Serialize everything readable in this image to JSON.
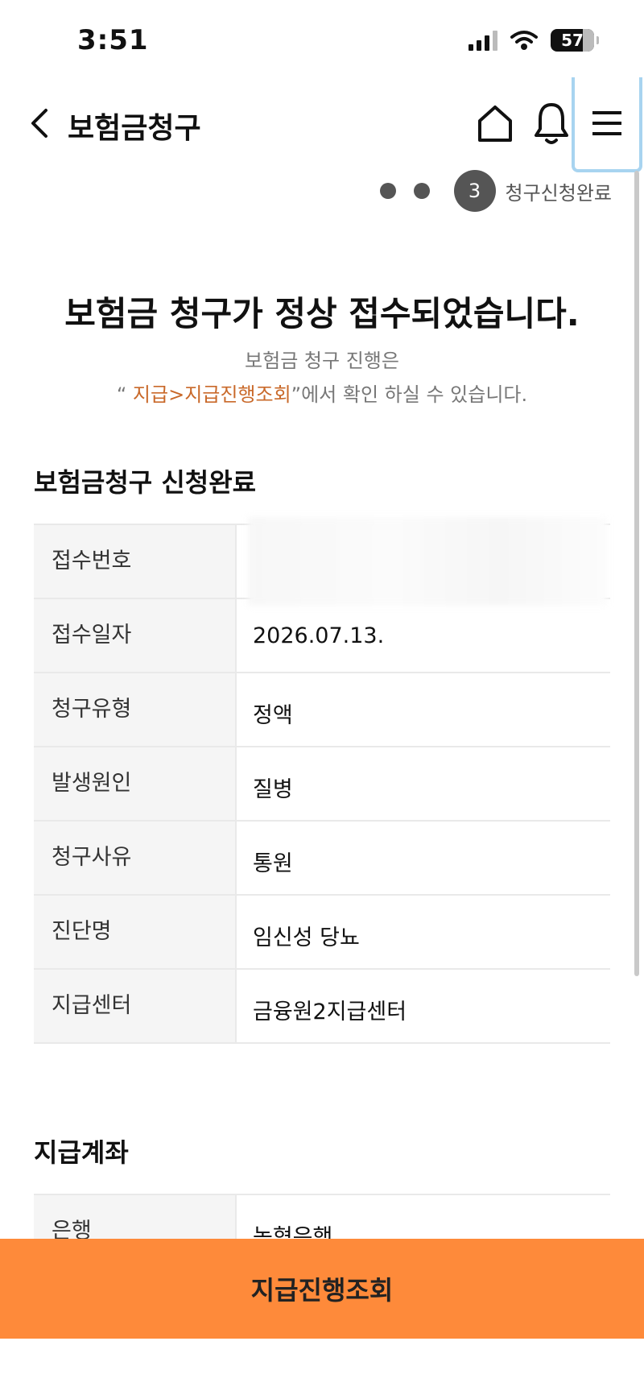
{
  "status_bar": {
    "time": "3:51",
    "battery": "57",
    "icons": [
      "signal-icon",
      "wifi-icon",
      "battery-icon"
    ]
  },
  "header": {
    "title": "보험금청구",
    "icons": [
      "back-chevron-icon",
      "home-icon",
      "bell-icon",
      "menu-icon"
    ]
  },
  "steps": {
    "current_number": "3",
    "current_label": "청구신청완료"
  },
  "message": {
    "headline": "보험금 청구가 정상 접수되었습니다.",
    "sub_line1": "보험금 청구 진행은",
    "sub_quote_open": "“ ",
    "sub_link": "지급>지급진행조회",
    "sub_quote_close": "”에서 확인 하실 수 있습니다."
  },
  "section1": {
    "title": "보험금청구 신청완료",
    "rows": [
      {
        "label": "접수번호",
        "value": ""
      },
      {
        "label": "접수일자",
        "value": "2026.07.13."
      },
      {
        "label": "청구유형",
        "value": "정액"
      },
      {
        "label": "발생원인",
        "value": "질병"
      },
      {
        "label": "청구사유",
        "value": "통원"
      },
      {
        "label": "진단명",
        "value": "임신성 당뇨"
      },
      {
        "label": "지급센터",
        "value": "금융원2지급센터"
      }
    ]
  },
  "section2": {
    "title": "지급계좌",
    "rows": [
      {
        "label": "은행",
        "value": "농협은행"
      }
    ]
  },
  "bottom_button": {
    "label": "지급진행조회"
  },
  "colors": {
    "accent": "#fe8a3a",
    "link": "#c9692a",
    "highlight_border": "#a8d4f0"
  }
}
